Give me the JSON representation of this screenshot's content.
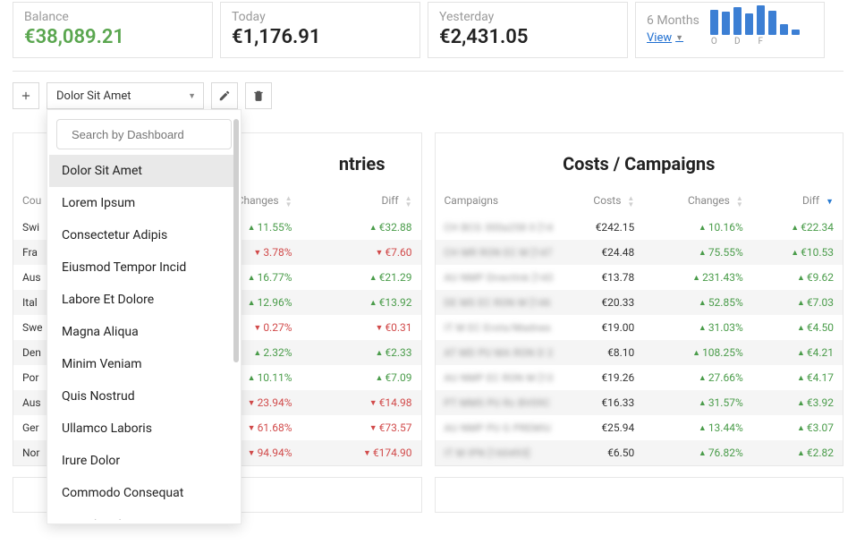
{
  "stats": {
    "balance": {
      "label": "Balance",
      "value": "€38,089.21"
    },
    "today": {
      "label": "Today",
      "value": "€1,176.91"
    },
    "yesterday": {
      "label": "Yesterday",
      "value": "€2,431.05"
    },
    "six": {
      "label": "6 Months",
      "view_label": "View",
      "ticks": [
        "O",
        "",
        "D",
        "",
        "F",
        ""
      ],
      "bars": [
        28,
        26,
        31,
        24,
        33,
        27,
        12,
        6
      ]
    }
  },
  "toolbar": {
    "add_icon": "plus-icon",
    "selected_dashboard": "Dolor Sit Amet",
    "edit_icon": "pencil-icon",
    "delete_icon": "trash-icon"
  },
  "dropdown": {
    "search_placeholder": "Search by Dashboard",
    "items": [
      "Dolor Sit Amet",
      "Lorem Ipsum",
      "Consectetur Adipis",
      "Eiusmod Tempor Incid",
      "Labore Et Dolore",
      "Magna Aliqua",
      "Minim Veniam",
      "Quis Nostrud",
      "Ullamco Laboris",
      "Irure Dolor",
      "Commodo Consequat",
      "Reprehenderit"
    ],
    "selected_index": 0
  },
  "countries_panel": {
    "title_visible_fragment": "ntries",
    "columns": {
      "country": "Cou",
      "changes": "Changes",
      "diff": "Diff"
    },
    "rows": [
      {
        "c": "Swi",
        "chg": "11.55%",
        "diff": "€32.88",
        "dir": "up"
      },
      {
        "c": "Fra",
        "chg": "3.78%",
        "diff": "€7.60",
        "dir": "down"
      },
      {
        "c": "Aus",
        "chg": "16.77%",
        "diff": "€21.29",
        "dir": "up"
      },
      {
        "c": "Ital",
        "chg": "12.96%",
        "diff": "€13.92",
        "dir": "up"
      },
      {
        "c": "Swe",
        "chg": "0.27%",
        "diff": "€0.31",
        "dir": "down"
      },
      {
        "c": "Den",
        "chg": "2.32%",
        "diff": "€2.33",
        "dir": "up"
      },
      {
        "c": "Por",
        "chg": "10.11%",
        "diff": "€7.09",
        "dir": "up"
      },
      {
        "c": "Aus",
        "chg": "23.94%",
        "diff": "€14.98",
        "dir": "down"
      },
      {
        "c": "Ger",
        "chg": "61.68%",
        "diff": "€73.57",
        "dir": "down"
      },
      {
        "c": "Nor",
        "chg": "94.94%",
        "diff": "€174.90",
        "dir": "down"
      }
    ]
  },
  "campaigns_panel": {
    "title": "Costs / Campaigns",
    "columns": {
      "campaigns": "Campaigns",
      "costs": "Costs",
      "changes": "Changes",
      "diff": "Diff"
    },
    "rows": [
      {
        "camp": "CH BCG 300a258 0 [14",
        "cost": "€242.15",
        "chg": "10.16%",
        "diff": "€22.34",
        "dir": "up"
      },
      {
        "camp": "CH MR RON EC M [147",
        "cost": "€24.48",
        "chg": "75.55%",
        "diff": "€10.53",
        "dir": "up"
      },
      {
        "camp": "AU NMP DirectInk [143",
        "cost": "€13.78",
        "chg": "231.43%",
        "diff": "€9.62",
        "dir": "up"
      },
      {
        "camp": "DE MS EC RON M [146",
        "cost": "€20.33",
        "chg": "52.85%",
        "diff": "€7.03",
        "dir": "up"
      },
      {
        "camp": "IT M EC Erots/Madnes",
        "cost": "€19.00",
        "chg": "31.03%",
        "diff": "€4.50",
        "dir": "up"
      },
      {
        "camp": "AT MD PU MA RON D 2",
        "cost": "€8.10",
        "chg": "108.25%",
        "diff": "€4.21",
        "dir": "up"
      },
      {
        "camp": "AU NMP EC RON M [13",
        "cost": "€19.26",
        "chg": "27.66%",
        "diff": "€4.17",
        "dir": "up"
      },
      {
        "camp": "PT MMS PU Rc BV09C",
        "cost": "€16.33",
        "chg": "31.57%",
        "diff": "€3.92",
        "dir": "up"
      },
      {
        "camp": "AU NMP PU G PREMIU",
        "cost": "€25.94",
        "chg": "13.44%",
        "diff": "€3.07",
        "dir": "up"
      },
      {
        "camp": "IT M IPN [160493]",
        "cost": "€6.50",
        "chg": "76.82%",
        "diff": "€2.82",
        "dir": "up"
      }
    ]
  }
}
